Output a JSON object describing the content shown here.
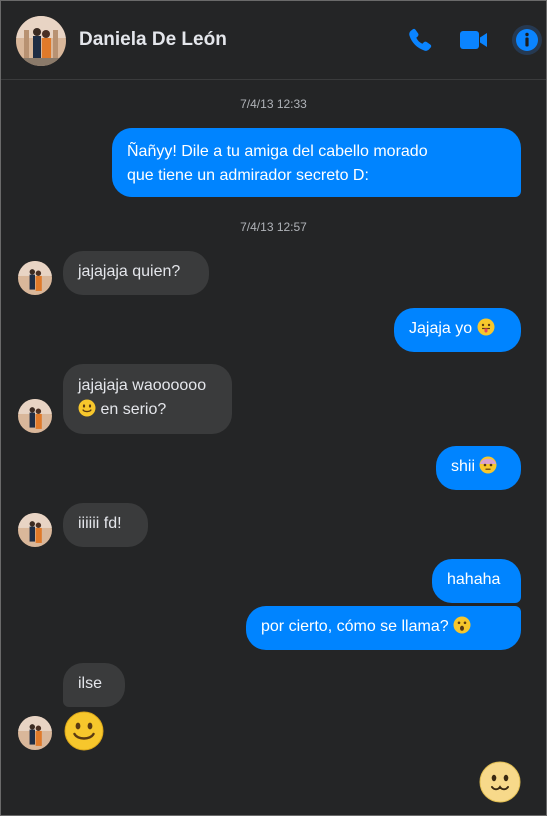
{
  "contact": {
    "name": "Daniela De León"
  },
  "header": {
    "icons": [
      "phone-icon",
      "video-camera-icon",
      "info-icon"
    ]
  },
  "colors": {
    "accent": "#0084ff",
    "background": "#242526",
    "incoming_bubble": "#3a3b3c",
    "text_primary": "#e4e6eb",
    "text_secondary": "#b0b3b8"
  },
  "timestamps": [
    "7/4/13 12:33",
    "7/4/13 12:57"
  ],
  "messages": [
    {
      "from": "me",
      "line1": "Ñañyy! Dile a tu amiga del cabello morado",
      "line2": "que tiene un admirador secreto D:"
    },
    {
      "from": "them",
      "text": "jajajaja quien?"
    },
    {
      "from": "me",
      "text": "Jajaja yo",
      "emoji": "tongue-out-emoji"
    },
    {
      "from": "them",
      "line1": "jajajaja waoooooo",
      "line2": "en serio?",
      "emoji": "smile-emoji"
    },
    {
      "from": "me",
      "text": "shii",
      "emoji": "blushing-dizzy-emoji"
    },
    {
      "from": "them",
      "text": "iiiiii fd!"
    },
    {
      "from": "me",
      "text": "hahaha"
    },
    {
      "from": "me",
      "text": "por cierto, cómo se llama?",
      "emoji": "surprised-emoji"
    },
    {
      "from": "them",
      "text": "ilse"
    },
    {
      "from": "them",
      "emoji": "big-smile-emoji"
    },
    {
      "from": "me",
      "emoji": "big-pursed-smile-emoji"
    }
  ]
}
